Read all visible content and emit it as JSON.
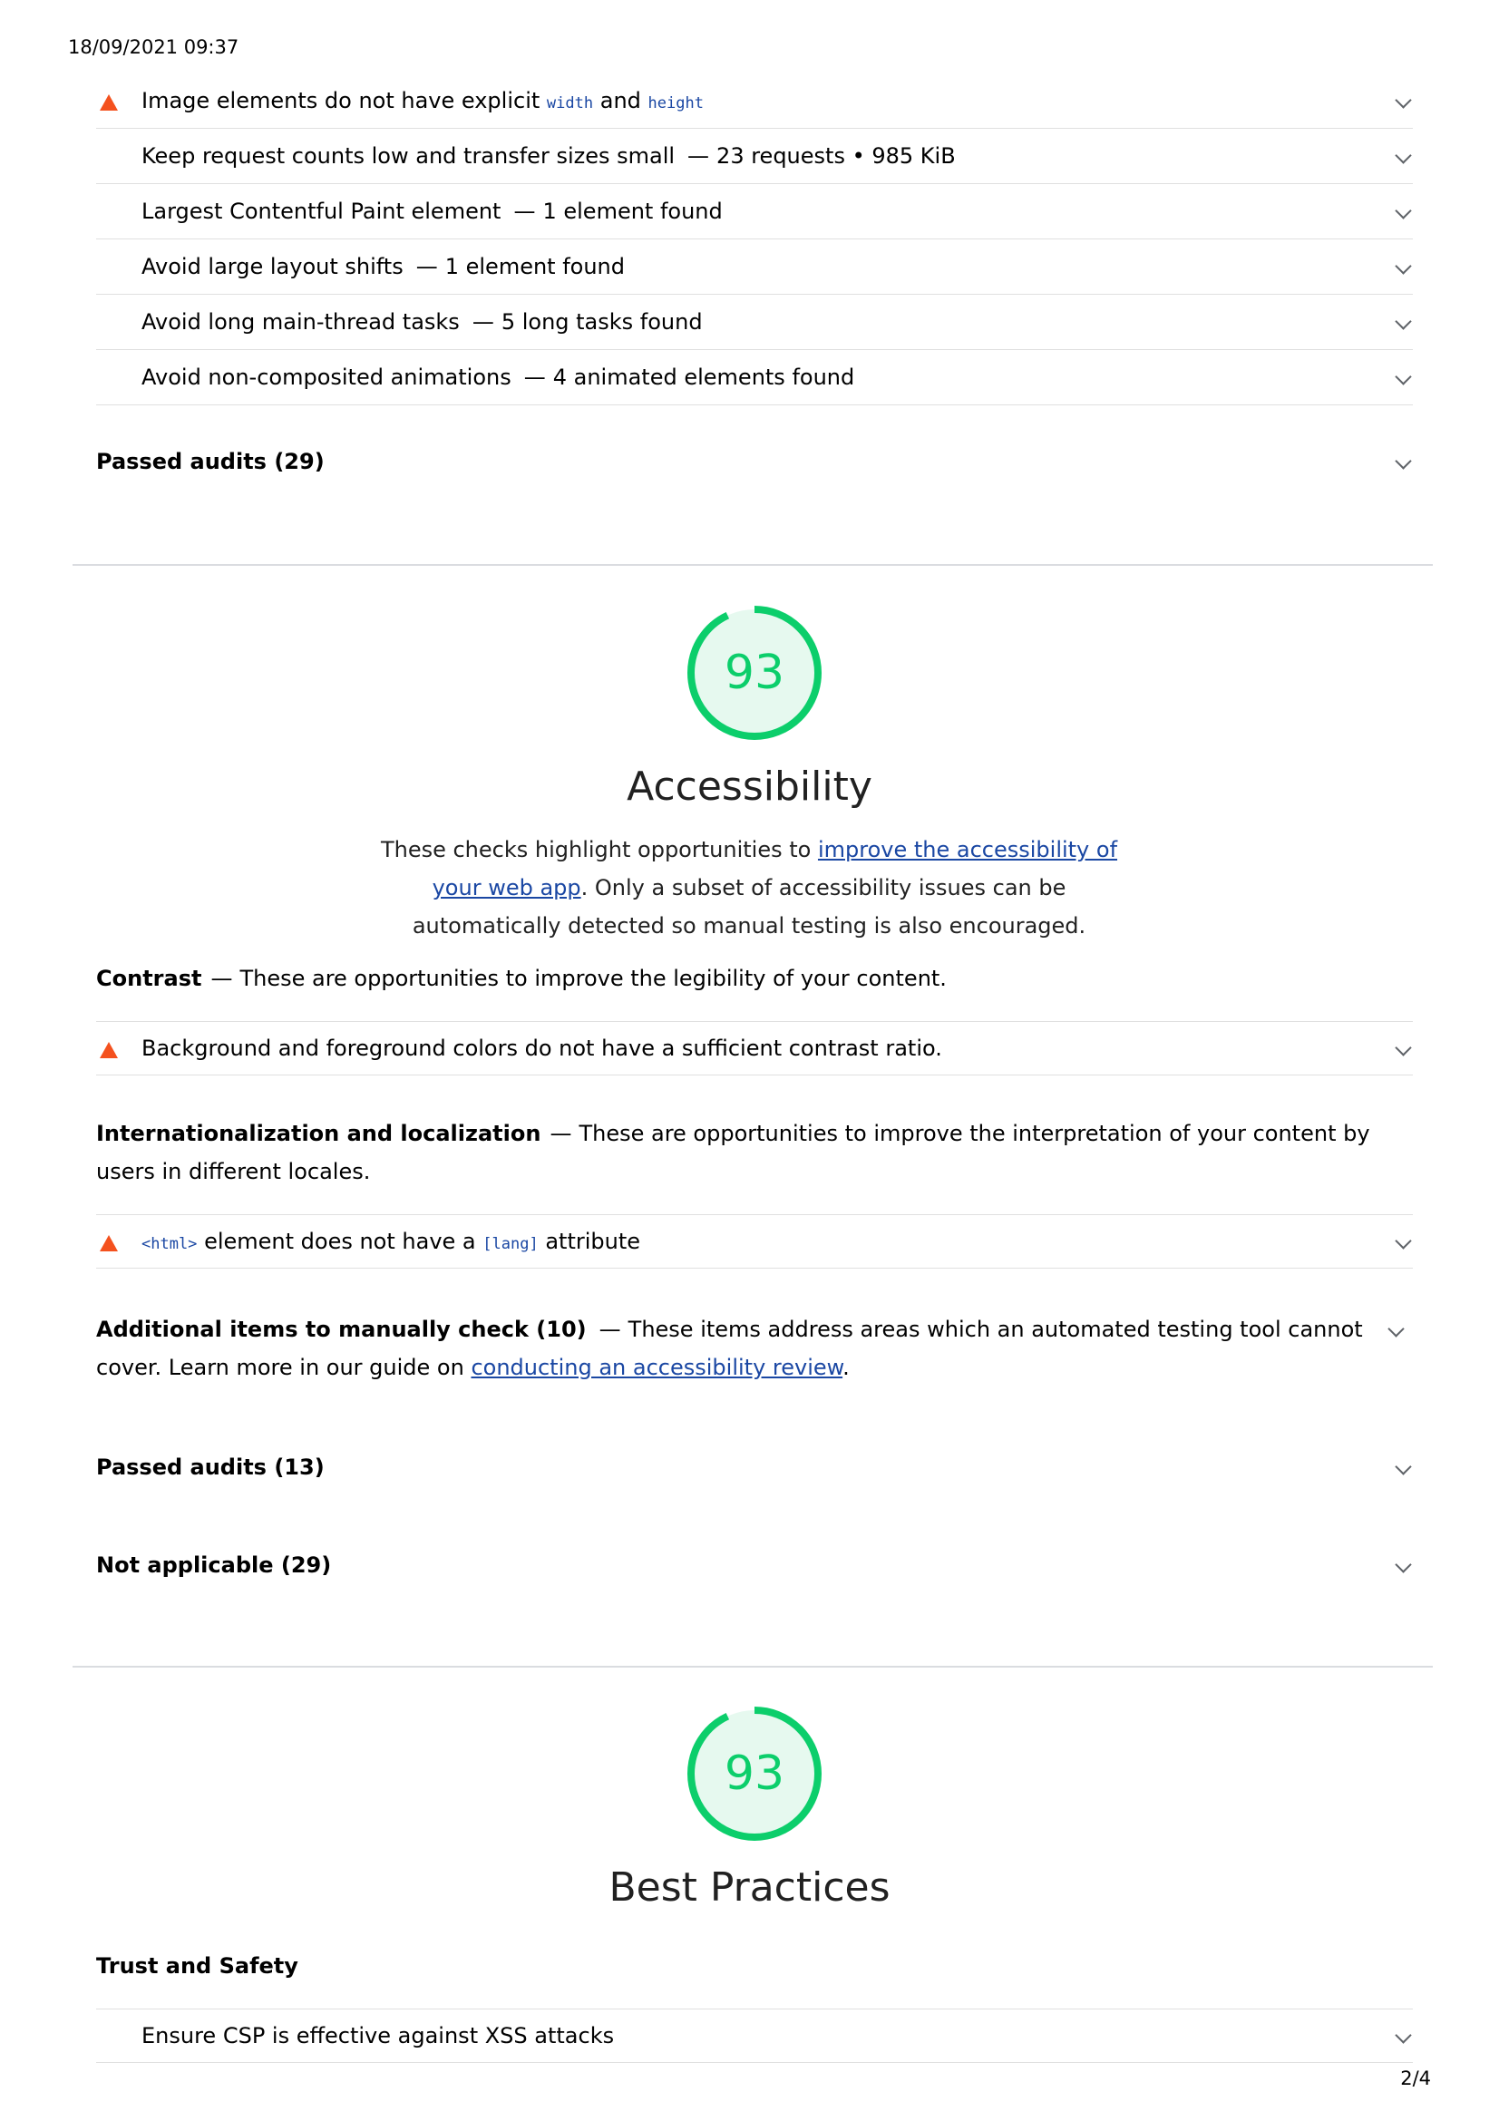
{
  "print_date": "18/09/2021 09:37",
  "page_number": "2/4",
  "performance": {
    "audits": [
      {
        "title_prefix": "Image elements do not have explicit",
        "code1": "width",
        "mid": "and",
        "code2": "height",
        "status": "fail"
      },
      {
        "title": "Keep request counts low and transfer sizes small",
        "detail": "23 requests • 985 KiB",
        "status": "info"
      },
      {
        "title": "Largest Contentful Paint element",
        "detail": "1 element found",
        "status": "info"
      },
      {
        "title": "Avoid large layout shifts",
        "detail": "1 element found",
        "status": "info"
      },
      {
        "title": "Avoid long main-thread tasks",
        "detail": "5 long tasks found",
        "status": "info"
      },
      {
        "title": "Avoid non-composited animations",
        "detail": "4 animated elements found",
        "status": "info"
      }
    ],
    "passed_label": "Passed audits (29)"
  },
  "accessibility": {
    "score": "93",
    "score_value": 0.93,
    "title": "Accessibility",
    "desc_before": "These checks highlight opportunities to",
    "desc_link": "improve the accessibility of your web app",
    "desc_after": ". Only a subset of accessibility issues can be automatically detected so manual testing is also encouraged.",
    "contrast": {
      "name": "Contrast",
      "desc": "These are opportunities to improve the legibility of your content.",
      "audit": "Background and foreground colors do not have a sufficient contrast ratio."
    },
    "i18n": {
      "name": "Internationalization and localization",
      "desc": "These are opportunities to improve the interpretation of your content by users in different locales.",
      "audit_code1": "<html>",
      "audit_mid": "element does not have a",
      "audit_code2": "[lang]",
      "audit_end": "attribute"
    },
    "manual": {
      "name": "Additional items to manually check (10)",
      "desc": "These items address areas which an automated testing tool cannot cover. Learn more in our guide on",
      "link": "conducting an accessibility review",
      "end": "."
    },
    "passed_label": "Passed audits (13)",
    "na_label": "Not applicable (29)"
  },
  "best_practices": {
    "score": "93",
    "score_value": 0.93,
    "title": "Best Practices",
    "group_name": "Trust and Safety",
    "audit": "Ensure CSP is effective against XSS attacks"
  },
  "colors": {
    "pass": "#0cce6b",
    "pass_bg": "#e6f9ef",
    "fail": "#f4511e",
    "link": "#1a47a3"
  },
  "icons": [
    "fail-triangle-icon",
    "chevron-down-icon"
  ]
}
